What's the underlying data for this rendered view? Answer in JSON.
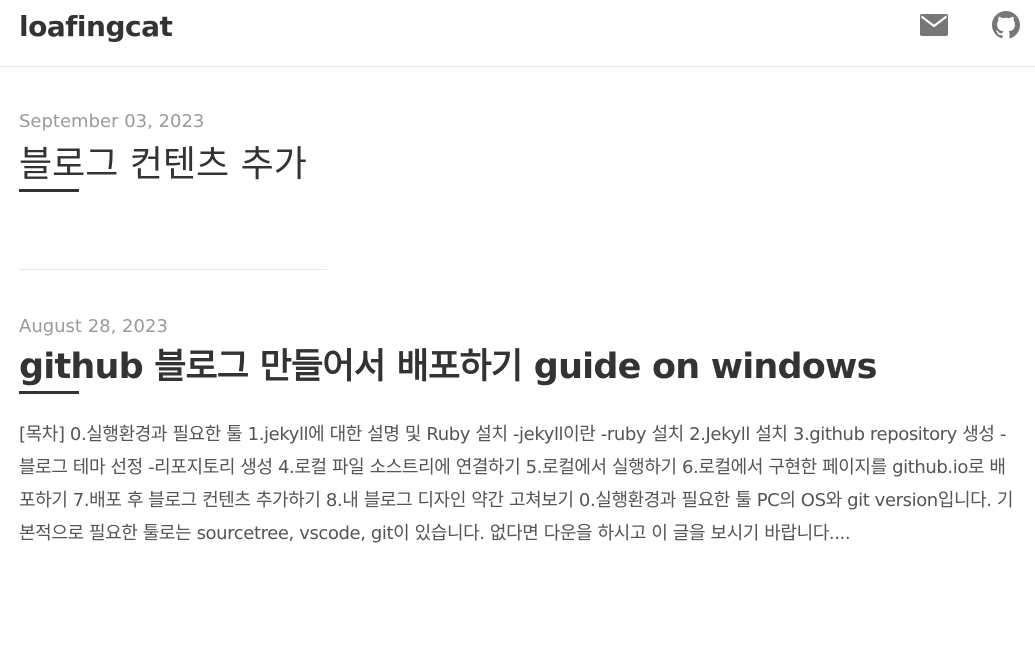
{
  "site": {
    "title": "loafingcat"
  },
  "header": {
    "icons": [
      "envelope-icon",
      "github-icon"
    ]
  },
  "posts": [
    {
      "date": "September 03, 2023",
      "title": "블로그 컨텐츠 추가"
    },
    {
      "date": "August 28, 2023",
      "title": "github 블로그 만들어서 배포하기 guide on windows",
      "excerpt": "[목차] 0.실행환경과 필요한 툴 1.jekyll에 대한 설명 및 Ruby 설치 -jekyll이란 -ruby 설치 2.Jekyll 설치 3.github repository 생성 -블로그 테마 선정 -리포지토리 생성 4.로컬 파일 소스트리에 연결하기 5.로컬에서 실행하기 6.로컬에서 구현한 페이지를 github.io로 배포하기 7.배포 후 블로그 컨텐츠 추가하기 8.내 블로그 디자인 약간 고쳐보기 0.실행환경과 필요한 툴 PC의 OS와 git version입니다. 기본적으로 필요한 툴로는 sourcetree, vscode, git이 있습니다. 없다면 다운을 하시고 이 글을 보시기 바랍니다...."
    }
  ],
  "colors": {
    "text": "#333333",
    "muted": "#9a9a9a",
    "icon": "#777777",
    "border": "#e6e6e6"
  }
}
